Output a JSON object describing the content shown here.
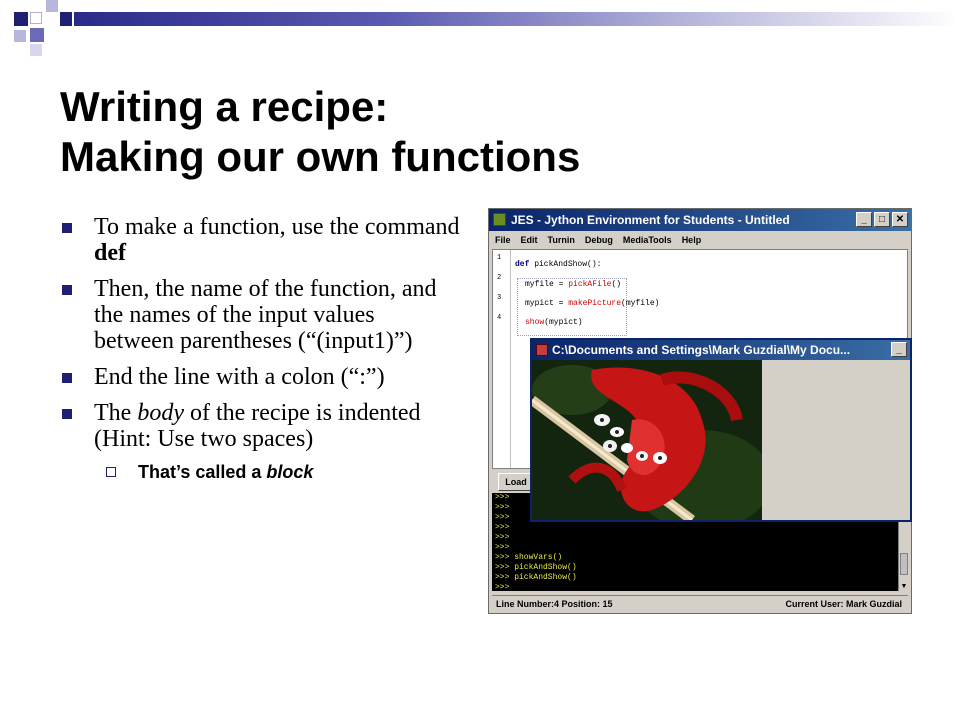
{
  "slide": {
    "title_line1": "Writing a recipe:",
    "title_line2": "Making our own functions",
    "bullets": [
      {
        "pre": "To make a function, use the command ",
        "bold": "def",
        "post": ""
      },
      {
        "text": "Then, the name of the function, and the names of the input values between parentheses (“(input1)”)"
      },
      {
        "text": "End the line with a colon (“:”)"
      },
      {
        "pre": "The ",
        "italic": "body",
        "post": " of the recipe is indented (Hint: Use two spaces)"
      }
    ],
    "sub_bullet": {
      "text": "That’s called a ",
      "italic": "block"
    },
    "colors": {
      "bullet": "#1f1f73",
      "bar_dark": "#2a2a8a"
    }
  },
  "jes": {
    "title": "JES - Jython Environment for Students - Untitled",
    "menu": [
      "File",
      "Edit",
      "Turnin",
      "Debug",
      "MediaTools",
      "Help"
    ],
    "line_numbers": [
      "1",
      "2",
      "3",
      "4"
    ],
    "code": {
      "l1_kw": "def",
      "l1_rest": " pickAndShow():",
      "l2_pre": "myfile = ",
      "l2_fn": "pickAFile",
      "l2_post": "()",
      "l3_pre": "mypict = ",
      "l3_fn": "makePicture",
      "l3_post": "(myfile)",
      "l4_fn": "show",
      "l4_post": "(mypict)"
    },
    "load_button": "Load",
    "console_lines": [
      ">>>",
      ">>>",
      ">>>",
      ">>>",
      ">>>",
      ">>>",
      ">>> showVars()",
      ">>> pickAndShow()",
      ">>> pickAndShow()",
      ">>>"
    ],
    "status_left": "Line Number:4 Position: 15",
    "status_right": "Current User: Mark Guzdial"
  },
  "picture_window": {
    "title": "C:\\Documents and Settings\\Mark Guzdial\\My Docu..."
  },
  "icons": {
    "minimize": "_",
    "maximize": "□",
    "close": "✕",
    "scroll_down": "▼"
  }
}
